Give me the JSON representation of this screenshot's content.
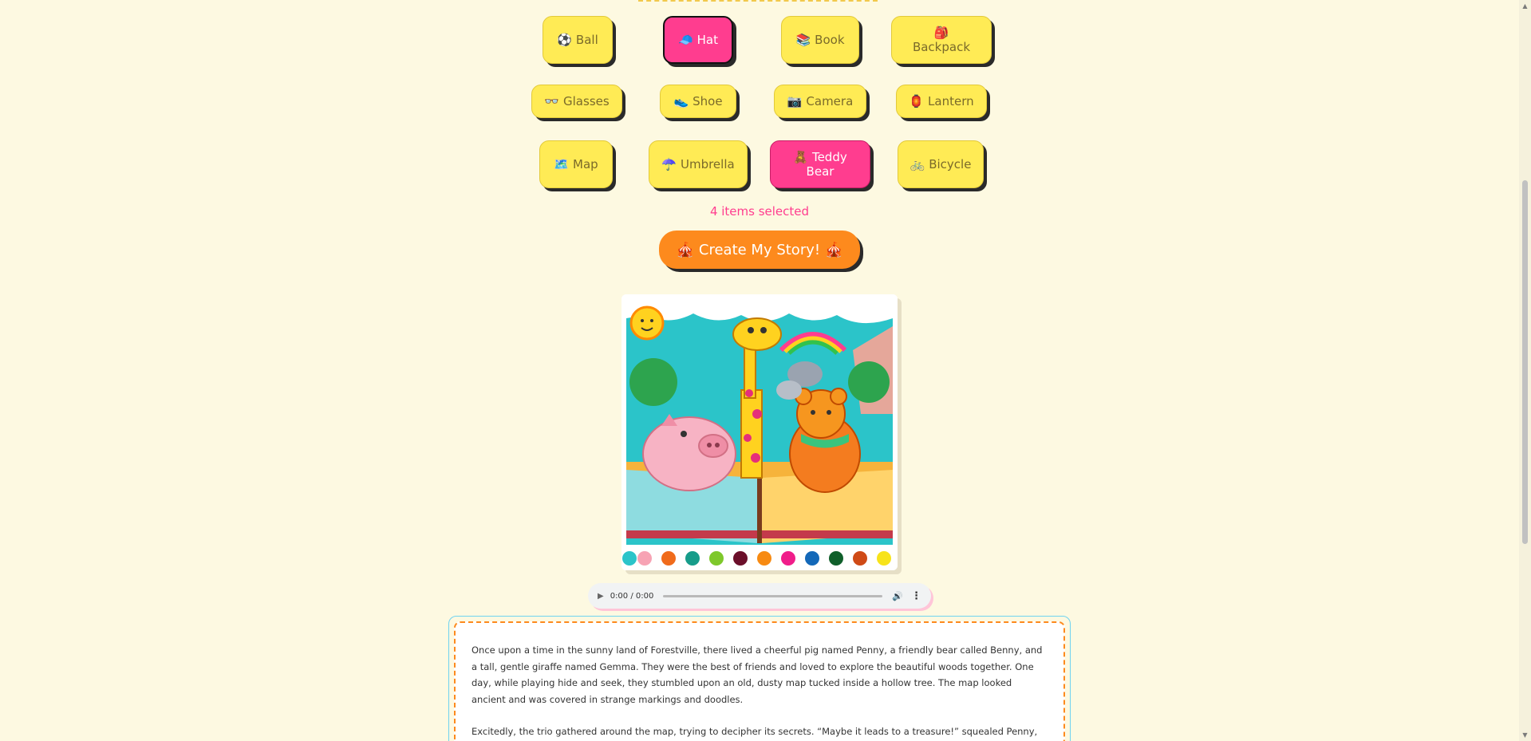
{
  "items": {
    "ball": {
      "emoji": "⚽",
      "label": "Ball"
    },
    "hat": {
      "emoji": "🧢",
      "label": "Hat"
    },
    "book": {
      "emoji": "📚",
      "label": "Book"
    },
    "backpack": {
      "emoji": "🎒",
      "label": "Backpack"
    },
    "glasses": {
      "emoji": "👓",
      "label": "Glasses"
    },
    "shoe": {
      "emoji": "👟",
      "label": "Shoe"
    },
    "camera": {
      "emoji": "📷",
      "label": "Camera"
    },
    "lantern": {
      "emoji": "🏮",
      "label": "Lantern"
    },
    "map": {
      "emoji": "🗺️",
      "label": "Map"
    },
    "umbrella": {
      "emoji": "☂️",
      "label": "Umbrella"
    },
    "teddy": {
      "emoji": "🧸",
      "label": "Teddy Bear"
    },
    "bicycle": {
      "emoji": "🚲",
      "label": "Bicycle"
    }
  },
  "selection_status": "4 items selected",
  "create_button": {
    "label": "Create My Story!",
    "icon": "🎪"
  },
  "audio": {
    "time": "0:00 / 0:00"
  },
  "story": {
    "paragraph_1": "Once upon a time in the sunny land of Forestville, there lived a cheerful pig named Penny, a friendly bear called Benny, and a tall, gentle giraffe named Gemma. They were the best of friends and loved to explore the beautiful woods together. One day, while playing hide and seek, they stumbled upon an old, dusty map tucked inside a hollow tree. The map looked ancient and was covered in strange markings and doodles.",
    "paragraph_2": "Excitedly, the trio gathered around the map, trying to decipher its secrets. “Maybe it leads to a treasure!” squealed Penny, her little"
  },
  "colors": {
    "background": "#fdf9e1",
    "item_button": "#ffeb55",
    "selected_button": "#ff3d8f",
    "create_button": "#fd8a1d",
    "story_border": "#fd8a1d",
    "story_outer_border": "#6fd3f0"
  }
}
